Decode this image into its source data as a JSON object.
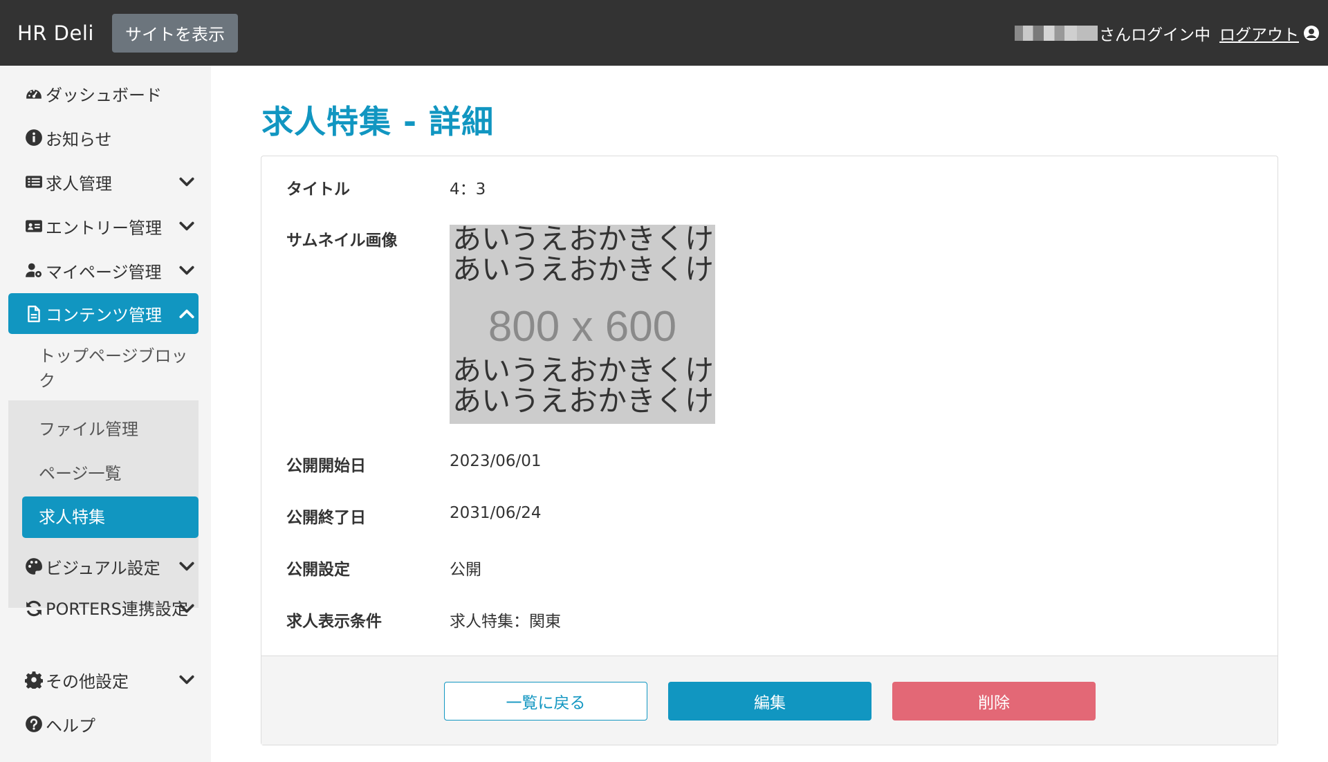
{
  "header": {
    "brand": "HR Deli",
    "site_button": "サイトを表示",
    "login_status": "さんログイン中",
    "logout": "ログアウト",
    "bg_color": "#333333"
  },
  "sidebar": {
    "items": [
      {
        "label": "ダッシュボード",
        "icon": "dashboard-icon"
      },
      {
        "label": "お知らせ",
        "icon": "info-icon"
      },
      {
        "label": "求人管理",
        "icon": "list-icon"
      },
      {
        "label": "エントリー管理",
        "icon": "id-card-icon"
      },
      {
        "label": "マイページ管理",
        "icon": "user-gear-icon"
      },
      {
        "label": "コンテンツ管理",
        "icon": "document-icon"
      },
      {
        "label": "ビジュアル設定",
        "icon": "palette-icon"
      },
      {
        "label": "PORTERS連携設定",
        "icon": "sync-icon"
      },
      {
        "label": "その他設定",
        "icon": "gear-icon"
      },
      {
        "label": "ヘルプ",
        "icon": "question-icon"
      }
    ],
    "content_submenu": [
      {
        "label": "トップページブロック"
      },
      {
        "label": "ファイル管理"
      },
      {
        "label": "ページ一覧"
      },
      {
        "label": "求人特集"
      }
    ],
    "accent_color": "#1196c1"
  },
  "main": {
    "title": "求人特集 - 詳細",
    "fields": {
      "title_label": "タイトル",
      "title_value": "4：3",
      "thumbnail_label": "サムネイル画像",
      "thumbnail_text_line": "あいうえおかきくけこさ",
      "thumbnail_size": "800 x 600",
      "start_label": "公開開始日",
      "start_value": "2023/06/01",
      "end_label": "公開終了日",
      "end_value": "2031/06/24",
      "publish_label": "公開設定",
      "publish_value": "公開",
      "condition_label": "求人表示条件",
      "condition_value": "求人特集：関東"
    },
    "buttons": {
      "back": "一覧に戻る",
      "edit": "編集",
      "delete": "削除"
    },
    "delete_color": "#e36876"
  }
}
